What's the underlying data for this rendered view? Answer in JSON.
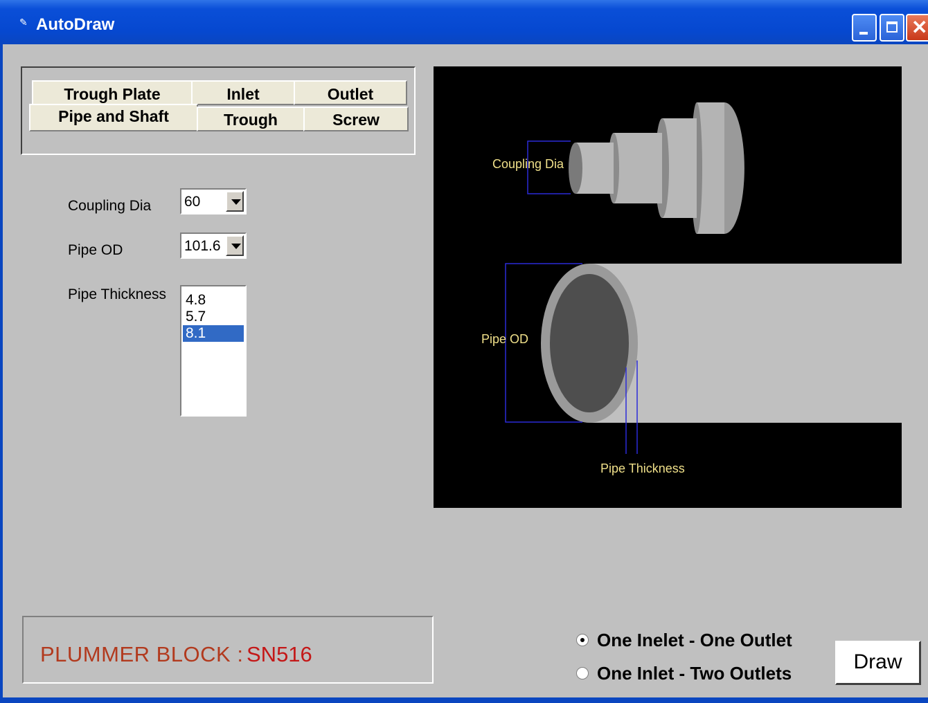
{
  "window": {
    "title": "AutoDraw"
  },
  "tabs": {
    "row1": [
      {
        "label": "Trough Plate"
      },
      {
        "label": "Inlet"
      },
      {
        "label": "Outlet"
      }
    ],
    "row2": [
      {
        "label": "Pipe and Shaft"
      },
      {
        "label": "Trough"
      },
      {
        "label": "Screw"
      }
    ]
  },
  "form": {
    "coupling_dia": {
      "label": "Coupling Dia",
      "value": "60"
    },
    "pipe_od": {
      "label": "Pipe OD",
      "value": "101.6"
    },
    "pipe_thickness": {
      "label": "Pipe Thickness",
      "options": [
        "4.8",
        "5.7",
        "8.1"
      ],
      "selected": "8.1"
    }
  },
  "drawing": {
    "labels": {
      "coupling_dia": "Coupling Dia",
      "pipe_od": "Pipe OD",
      "pipe_thickness": "Pipe Thickness"
    }
  },
  "status": {
    "label": "PLUMMER BLOCK :",
    "value": "SN516"
  },
  "radios": [
    {
      "label": "One Inelet - One Outlet",
      "checked": true
    },
    {
      "label": "One Inlet - Two Outlets",
      "checked": false
    }
  ],
  "actions": {
    "draw_label": "Draw"
  },
  "colors": {
    "title_bar": "#0a4fd8",
    "status_text": "#c41818",
    "annotation_text": "#f0e08a",
    "dimension_lines": "#2b2bd8",
    "selection": "#316ac5"
  }
}
